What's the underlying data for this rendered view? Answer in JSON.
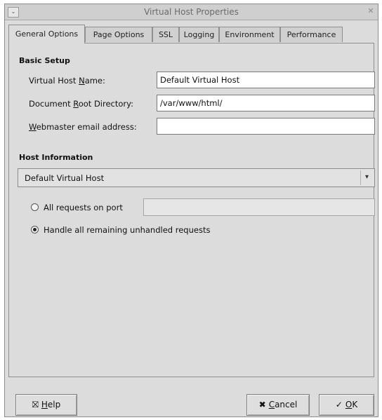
{
  "window": {
    "title": "Virtual Host Properties",
    "menu_glyph": "⌄",
    "close_glyph": "✕"
  },
  "tabs": [
    {
      "label": "General Options",
      "active": true
    },
    {
      "label": "Page Options",
      "active": false
    },
    {
      "label": "SSL",
      "active": false
    },
    {
      "label": "Logging",
      "active": false
    },
    {
      "label": "Environment",
      "active": false
    },
    {
      "label": "Performance",
      "active": false
    }
  ],
  "basic_setup": {
    "title": "Basic Setup",
    "vhost_name": {
      "label_pre": "Virtual Host ",
      "label_key": "N",
      "label_post": "ame:",
      "value": "Default Virtual Host"
    },
    "doc_root": {
      "label_pre": "Document ",
      "label_key": "R",
      "label_post": "oot Directory:",
      "value": "/var/www/html/"
    },
    "webmaster": {
      "label_pre": "",
      "label_key": "W",
      "label_post": "ebmaster email address:",
      "value": ""
    }
  },
  "host_information": {
    "title": "Host Information",
    "selected": "Default Virtual Host",
    "arrow_glyph": "▾",
    "radio_port_label": "All requests on port",
    "port_value": "",
    "radio_default_label": "Handle all remaining unhandled requests",
    "radio_default_checked": true
  },
  "buttons": {
    "help": {
      "icon": "⛝",
      "label_key": "H",
      "label_post": "elp"
    },
    "cancel": {
      "icon": "✖",
      "label_key": "C",
      "label_post": "ancel"
    },
    "ok": {
      "icon": "✓",
      "label_key": "O",
      "label_post": "K"
    }
  }
}
